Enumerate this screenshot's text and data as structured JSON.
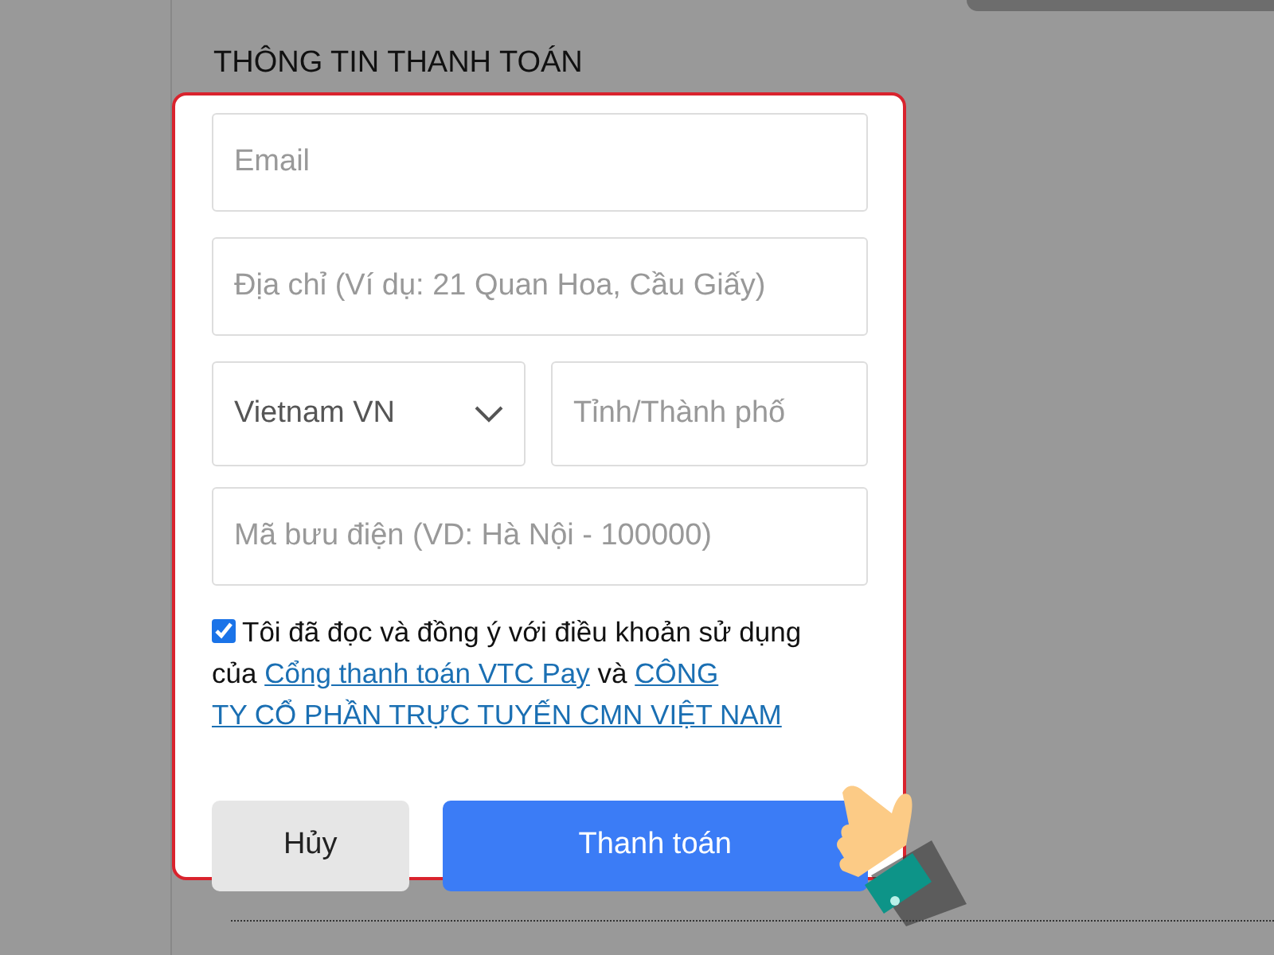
{
  "heading": "THÔNG TIN THANH TOÁN",
  "form": {
    "email": {
      "placeholder": "Email"
    },
    "address": {
      "placeholder": "Địa chỉ (Ví dụ: 21 Quan Hoa, Cầu Giấy)"
    },
    "country": {
      "value": "Vietnam VN"
    },
    "province": {
      "placeholder": "Tỉnh/Thành phố"
    },
    "postal": {
      "placeholder": "Mã bưu điện (VD: Hà Nội - 100000)"
    },
    "agreement": {
      "checked": true,
      "parts": [
        {
          "kind": "text",
          "text": "Tôi đã đọc và đồng ý với điều khoản sử dụng của"
        },
        {
          "kind": "link",
          "text": "Cổng thanh toán VTC Pay"
        },
        {
          "kind": "text",
          "text": "và"
        },
        {
          "kind": "link",
          "lines": [
            "CÔNG",
            "TY CỔ PHẦN TRỰC TUYẾN CMN VIỆT NAM"
          ]
        }
      ]
    },
    "buttons": [
      {
        "kind": "secondary",
        "label": "Hủy"
      },
      {
        "kind": "primary",
        "label": "Thanh toán"
      }
    ]
  }
}
